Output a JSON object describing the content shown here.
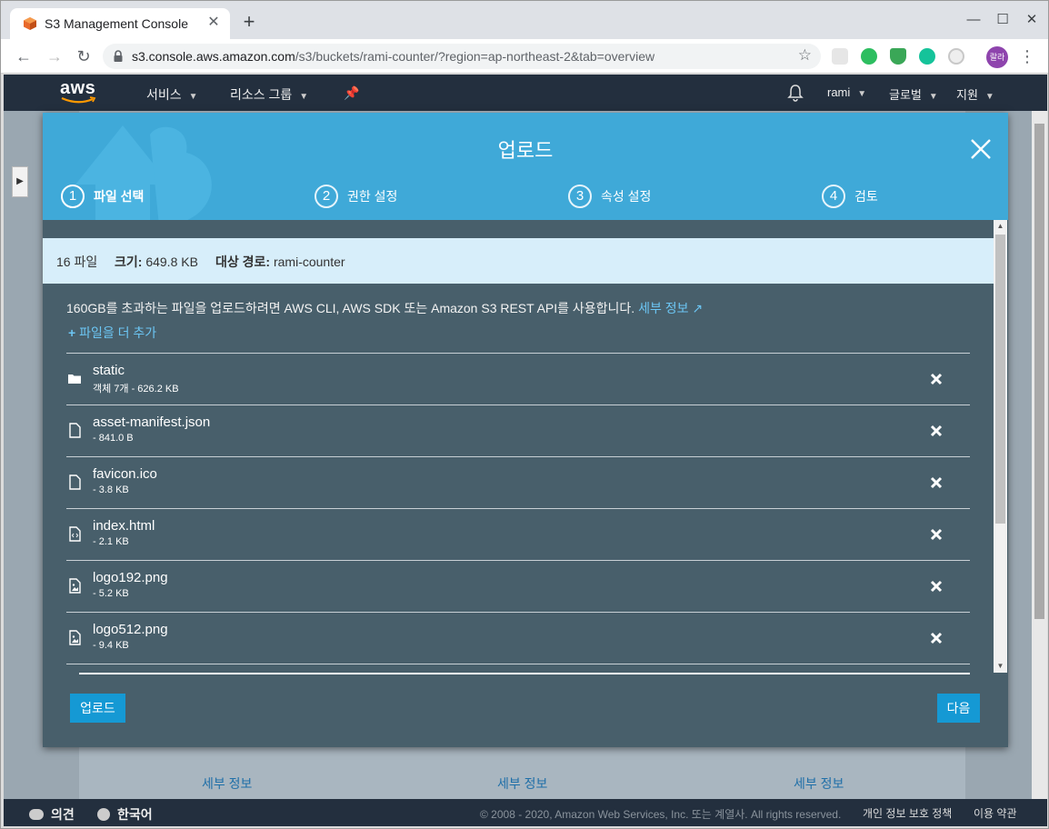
{
  "browser": {
    "tab_title": "S3 Management Console",
    "new_tab": "+",
    "url_host": "s3.console.aws.amazon.com",
    "url_path": "/s3/buckets/rami-counter/?region=ap-northeast-2&tab=overview",
    "profile_label": "랄라"
  },
  "aws_nav": {
    "logo": "aws",
    "services": "서비스",
    "resource_groups": "리소스 그룹",
    "user": "rami",
    "region": "글로벌",
    "support": "지원"
  },
  "modal": {
    "title": "업로드",
    "steps": [
      {
        "num": "1",
        "label": "파일 선택"
      },
      {
        "num": "2",
        "label": "권한 설정"
      },
      {
        "num": "3",
        "label": "속성 설정"
      },
      {
        "num": "4",
        "label": "검토"
      }
    ],
    "summary": {
      "files": "16 파일",
      "size_label": "크기:",
      "size_value": "649.8 KB",
      "dest_label": "대상 경로:",
      "dest_value": "rami-counter"
    },
    "info_text": "160GB를 초과하는 파일을 업로드하려면 AWS CLI, AWS SDK 또는 Amazon S3 REST API를 사용합니다.",
    "info_link": "세부 정보",
    "add_more": "파일을 더 추가",
    "files": [
      {
        "name": "static",
        "meta": "객체 7개 - 626.2 KB",
        "icon": "folder-icon"
      },
      {
        "name": "asset-manifest.json",
        "meta": "- 841.0 B",
        "icon": "file-icon"
      },
      {
        "name": "favicon.ico",
        "meta": "- 3.8 KB",
        "icon": "file-icon"
      },
      {
        "name": "index.html",
        "meta": "- 2.1 KB",
        "icon": "code-file-icon"
      },
      {
        "name": "logo192.png",
        "meta": "- 5.2 KB",
        "icon": "image-file-icon"
      },
      {
        "name": "logo512.png",
        "meta": "- 9.4 KB",
        "icon": "image-file-icon"
      }
    ],
    "upload_button": "업로드",
    "next_button": "다음"
  },
  "background": {
    "links": [
      "세부 정보",
      "세부 정보",
      "세부 정보"
    ]
  },
  "footer": {
    "feedback": "의견",
    "language": "한국어",
    "copyright": "© 2008 - 2020, Amazon Web Services, Inc. 또는 계열사. All rights reserved.",
    "privacy": "개인 정보 보호 정책",
    "terms": "이용 약관"
  },
  "colors": {
    "aws_nav": "#232f3e",
    "modal_header": "#3fa9d8",
    "modal_body": "#485f6b",
    "summary_bg": "#d7eefa",
    "link": "#6cc6f4",
    "button": "#1599d4"
  }
}
